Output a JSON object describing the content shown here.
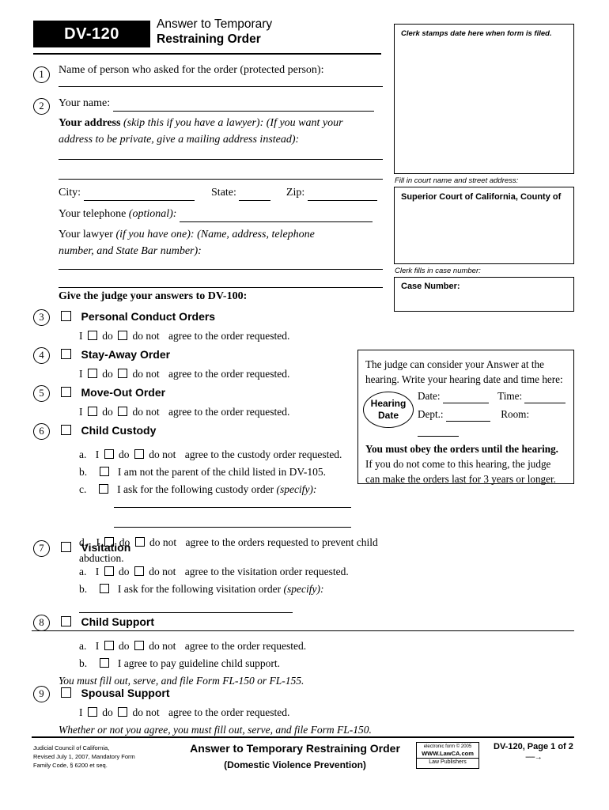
{
  "header": {
    "form_code": "DV-120",
    "title_line1": "Answer to Temporary",
    "title_line2": "Restraining Order"
  },
  "right_column": {
    "clerk_stamp_label": "Clerk stamps date here when form is filed.",
    "court_fill_label": "Fill in court name and street address:",
    "court_name": "Superior Court of California, County of",
    "case_fill_label": "Clerk fills in case number:",
    "case_number_label": "Case Number:"
  },
  "items": {
    "n1": {
      "num": "1",
      "text": "Name of person who asked for the order (protected person):"
    },
    "n2": {
      "num": "2",
      "your_name": "Your name:",
      "your_address_bold": "Your address",
      "your_address_italic": "(skip this if you have a lawyer): (If you want your",
      "your_address_italic2": "address to be private, give a mailing address instead):",
      "city": "City:",
      "state": "State:",
      "zip": "Zip:",
      "telephone": "Your telephone",
      "telephone_italic": "(optional):",
      "lawyer": "Your lawyer",
      "lawyer_italic": "(if you have one): (Name, address, telephone",
      "lawyer_italic2": "number, and State Bar number):"
    },
    "give_judge": "Give the judge your answers to DV-100:",
    "n3": {
      "num": "3",
      "heading": "Personal Conduct Orders",
      "line": "I ☐ do ☐ do not  agree to the order requested.",
      "i": "I",
      "do": "do",
      "do_not": "do not",
      "agree": "agree to the order requested."
    },
    "n4": {
      "num": "4",
      "heading": "Stay-Away Order",
      "i": "I",
      "do": "do",
      "do_not": "do not",
      "agree": "agree to the order requested."
    },
    "n5": {
      "num": "5",
      "heading": "Move-Out Order",
      "i": "I",
      "do": "do",
      "do_not": "do not",
      "agree": "agree to the order requested."
    },
    "n6": {
      "num": "6",
      "heading": "Child Custody",
      "a_label": "a.",
      "a_i": "I",
      "a_do": "do",
      "a_do_not": "do not",
      "a_text": "agree to the custody order requested.",
      "b_label": "b.",
      "b_text": "I am not the parent of the child listed in DV-105.",
      "c_label": "c.",
      "c_text": "I ask for the following custody order",
      "c_italic": "(specify):",
      "d_label": "d.",
      "d_i": "I",
      "d_do": "do",
      "d_do_not": "do not",
      "d_text": "agree to the orders requested to prevent child abduction."
    },
    "n7": {
      "num": "7",
      "heading": "Visitation",
      "a_label": "a.",
      "a_i": "I",
      "a_do": "do",
      "a_do_not": "do not",
      "a_text": "agree to the visitation order requested.",
      "b_label": "b.",
      "b_text": "I ask for the following visitation order",
      "b_italic": "(specify):"
    },
    "n8": {
      "num": "8",
      "heading": "Child Support",
      "a_label": "a.",
      "a_i": "I",
      "a_do": "do",
      "a_do_not": "do not",
      "a_text": "agree to the order requested.",
      "b_label": "b.",
      "b_text": "I agree to pay guideline child support.",
      "note": "You must fill out, serve, and file Form FL-150 or FL-155."
    },
    "n9": {
      "num": "9",
      "heading": "Spousal Support",
      "i": "I",
      "do": "do",
      "do_not": "do not",
      "agree": "agree to the order requested.",
      "note": "Whether or not you agree, you must fill out, serve, and file Form FL-150."
    }
  },
  "hearing_box": {
    "line1": "The judge can consider your Answer at the",
    "line2": "hearing. Write your hearing date and time here:",
    "oval_line1": "Hearing",
    "oval_line2": "Date",
    "date_label": "Date:",
    "time_label": "Time:",
    "dept_label": "Dept.:",
    "room_label": "Room:",
    "bold_line": "You must obey the orders until the hearing.",
    "line3": "If you do not come to this hearing, the judge",
    "line4": "can make the orders last for 3 years or longer."
  },
  "footer": {
    "left_line1": "Judicial Council of California,",
    "left_line2": "Revised July 1, 2007, Mandatory Form",
    "left_line3": "Family Code, § 6200 et seq.",
    "center_title": "Answer to Temporary Restraining Order",
    "center_subtitle": "(Domestic Violence Prevention)",
    "publisher_line1": "electronic form © 2005",
    "publisher_line2": "WWW.LawCA.com",
    "publisher_line3": "Law Publishers",
    "right_text": "DV-120, Page 1 of 2",
    "right_arrow": "‑‑‑‑‑→"
  }
}
